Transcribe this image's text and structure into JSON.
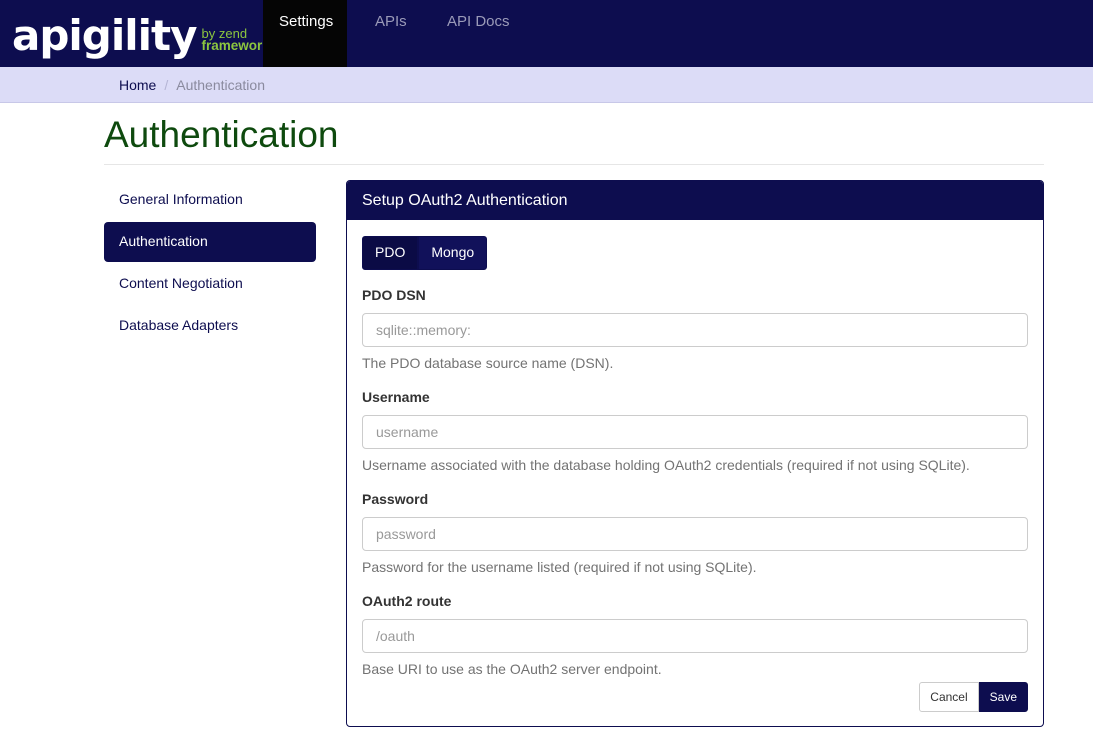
{
  "brand": {
    "name": "apigility",
    "by": "by zend",
    "framework": "framework"
  },
  "nav": {
    "items": [
      {
        "label": "Settings",
        "active": true
      },
      {
        "label": "APIs",
        "active": false
      },
      {
        "label": "API Docs",
        "active": false
      }
    ]
  },
  "breadcrumb": {
    "home": "Home",
    "current": "Authentication"
  },
  "page": {
    "title": "Authentication"
  },
  "sidebar": {
    "items": [
      {
        "label": "General Information",
        "active": false
      },
      {
        "label": "Authentication",
        "active": true
      },
      {
        "label": "Content Negotiation",
        "active": false
      },
      {
        "label": "Database Adapters",
        "active": false
      }
    ]
  },
  "panel": {
    "heading": "Setup OAuth2 Authentication",
    "adapter_tabs": [
      "PDO",
      "Mongo"
    ],
    "fields": [
      {
        "label": "PDO DSN",
        "placeholder": "sqlite::memory:",
        "value": "",
        "help": "The PDO database source name (DSN)."
      },
      {
        "label": "Username",
        "placeholder": "username",
        "value": "",
        "help": "Username associated with the database holding OAuth2 credentials (required if not using SQLite)."
      },
      {
        "label": "Password",
        "placeholder": "password",
        "value": "",
        "help": "Password for the username listed (required if not using SQLite)."
      },
      {
        "label": "OAuth2 route",
        "placeholder": "/oauth",
        "value": "",
        "help": "Base URI to use as the OAuth2 server endpoint."
      }
    ],
    "cancel_label": "Cancel",
    "save_label": "Save"
  },
  "colors": {
    "navy": "#0d0d4f",
    "breadcrumb_bg": "#dcdcf7",
    "title_green": "#0e4a0e",
    "brand_green": "#8cc63f"
  }
}
